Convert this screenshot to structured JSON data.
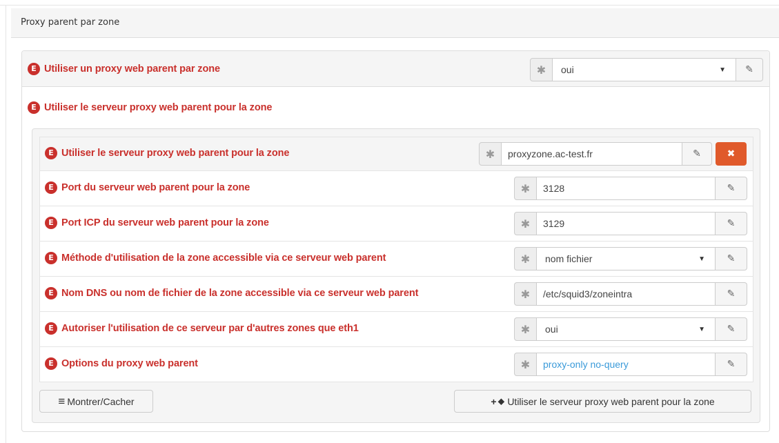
{
  "panel": {
    "title": "Proxy parent par zone"
  },
  "badge": "E",
  "main": {
    "use_parent_label": "Utiliser un proxy web parent par zone",
    "use_parent_value": "oui",
    "zone_section_label": "Utiliser le serveur proxy web parent pour la zone"
  },
  "rows": [
    {
      "label": "Utiliser le serveur proxy web parent pour la zone",
      "value": "proxyzone.ac-test.fr",
      "kind": "text"
    },
    {
      "label": "Port du serveur web parent pour la zone",
      "value": "3128",
      "kind": "text"
    },
    {
      "label": "Port ICP du serveur web parent pour la zone",
      "value": "3129",
      "kind": "text"
    },
    {
      "label": "Méthode d'utilisation de la zone accessible via ce serveur web parent",
      "value": "nom fichier",
      "kind": "select"
    },
    {
      "label": "Nom DNS ou nom de fichier de la zone accessible via ce serveur web parent",
      "value": "/etc/squid3/zoneintra",
      "kind": "text"
    },
    {
      "label": "Autoriser l'utilisation de ce serveur par d'autres zones que eth1",
      "value": "oui",
      "kind": "select"
    },
    {
      "label": "Options du proxy web parent",
      "value": "proxy-only no-query",
      "kind": "text"
    }
  ],
  "icons": {
    "required": "✱",
    "edit": "✎",
    "remove": "✖",
    "caret": "▼",
    "menu": "≡",
    "plus": "+",
    "tag": "⬥"
  },
  "footer": {
    "toggle_label": "Montrer/Cacher",
    "add_label": "Utiliser le serveur proxy web parent pour la zone"
  },
  "colors": {
    "accent": "#c9302c",
    "danger_button": "#e05a2b",
    "link_value": "#3a9ad9"
  }
}
